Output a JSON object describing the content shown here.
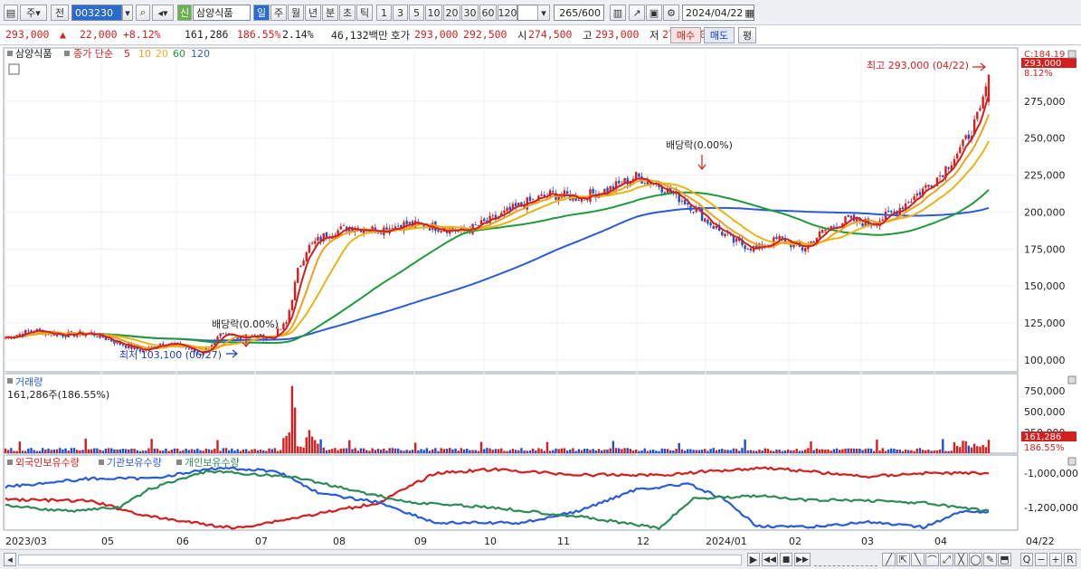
{
  "toolbar": {
    "market_label": "주",
    "jeon_label": "전",
    "code_value": "003230",
    "name_badge": "신",
    "stock_name": "삼양식품",
    "periods": [
      "일",
      "주",
      "월",
      "년",
      "분",
      "초",
      "틱"
    ],
    "active_period": "일",
    "intervals": [
      "1",
      "3",
      "5",
      "10",
      "20",
      "30",
      "60",
      "120"
    ],
    "count_value": "265",
    "count_total": "/600",
    "date_value": "2024/04/22"
  },
  "quote": {
    "price": "293,000",
    "change": "22,000",
    "change_pct": "+8.12%",
    "volume": "161,286",
    "volume_ratio": "186.55%",
    "turnover": "2.14%",
    "amount": "46,132백만",
    "hoga_label": "호가",
    "ask": "293,000",
    "bid": "292,500",
    "open_label": "시",
    "open": "274,500",
    "high_label": "고",
    "high": "293,000",
    "low_label": "저",
    "low": "272,000",
    "buy_label": "매수",
    "sell_label": "매도",
    "pyeong_label": "평"
  },
  "price_panel": {
    "name_label": "삼양식품",
    "ma_label": "종가 단순",
    "ma_periods": [
      "5",
      "10",
      "20",
      "60",
      "120"
    ],
    "c_label": "C:184.19",
    "last_price_tag": "293,000",
    "last_pct_tag": "8.12%",
    "high_annotation": "최고 293,000 (04/22)",
    "low_annotation": "최저 103,100 (06/27)",
    "dividend_label_1": "배당락(0.00%)",
    "dividend_label_2": "배당락(0.00%)"
  },
  "volume_panel": {
    "title": "거래량",
    "value_label": "161,286주(186.55%)",
    "last_tag": "161,286",
    "last_pct_tag": "186.55%"
  },
  "investor_panel": {
    "legend": [
      "외국인보유수량",
      "기관보유수량",
      "개인보유수량"
    ]
  },
  "x_axis": {
    "labels": [
      "2023/03",
      "05",
      "06",
      "07",
      "08",
      "09",
      "10",
      "11",
      "12",
      "2024/01",
      "02",
      "03",
      "04"
    ],
    "right_label": "04/22"
  },
  "chart_data": {
    "type": "candlestick",
    "ylim": [
      95000,
      300000
    ],
    "y_ticks": [
      "275,000",
      "250,000",
      "225,000",
      "200,000",
      "175,000",
      "150,000",
      "125,000",
      "100,000"
    ],
    "volume_ticks": [
      "750,000",
      "500,000",
      "250,000"
    ],
    "investor_ticks": [
      "-1,000,000",
      "-1,200,000"
    ],
    "series": [
      {
        "name": "5",
        "color": "#d21f1f"
      },
      {
        "name": "10",
        "color": "#f0a21c"
      },
      {
        "name": "20",
        "color": "#e8b514"
      },
      {
        "name": "60",
        "color": "#1f9a3a"
      },
      {
        "name": "120",
        "color": "#2a5bd8"
      }
    ],
    "close_keypoints": [
      [
        0,
        115000
      ],
      [
        10,
        120000
      ],
      [
        20,
        117000
      ],
      [
        30,
        118000
      ],
      [
        40,
        111000
      ],
      [
        48,
        106000
      ],
      [
        55,
        112000
      ],
      [
        62,
        109000
      ],
      [
        68,
        104000
      ],
      [
        75,
        116000
      ],
      [
        85,
        116000
      ],
      [
        93,
        115000
      ],
      [
        98,
        125000
      ],
      [
        102,
        160000
      ],
      [
        105,
        175000
      ],
      [
        112,
        185000
      ],
      [
        120,
        190000
      ],
      [
        130,
        188000
      ],
      [
        140,
        192000
      ],
      [
        150,
        190000
      ],
      [
        160,
        187000
      ],
      [
        170,
        195000
      ],
      [
        180,
        205000
      ],
      [
        190,
        212000
      ],
      [
        200,
        210000
      ],
      [
        210,
        215000
      ],
      [
        220,
        224000
      ],
      [
        228,
        218000
      ],
      [
        238,
        206000
      ],
      [
        246,
        192000
      ],
      [
        254,
        180000
      ],
      [
        262,
        175000
      ],
      [
        270,
        182000
      ],
      [
        278,
        175000
      ],
      [
        286,
        188000
      ],
      [
        294,
        195000
      ],
      [
        302,
        192000
      ],
      [
        310,
        200000
      ],
      [
        318,
        212000
      ],
      [
        326,
        225000
      ],
      [
        334,
        245000
      ],
      [
        340,
        267000
      ],
      [
        343,
        293000
      ]
    ],
    "ma_colors": {
      "ma5": "#d21f1f",
      "ma10": "#f0a21c",
      "ma20": "#e8b514",
      "ma60": "#1f9a3a",
      "ma120": "#2a5bd8"
    },
    "investor_series": [
      {
        "name": "외국인보유수량",
        "color": "#d21f1f"
      },
      {
        "name": "기관보유수량",
        "color": "#2a5bd8"
      },
      {
        "name": "개인보유수량",
        "color": "#2e8b57"
      }
    ]
  },
  "bottom": {
    "nav_buttons": [
      "▶",
      "◀◀",
      "■",
      "▶▶"
    ],
    "zoom_buttons": [
      "Q",
      "−",
      "+",
      "R"
    ]
  }
}
